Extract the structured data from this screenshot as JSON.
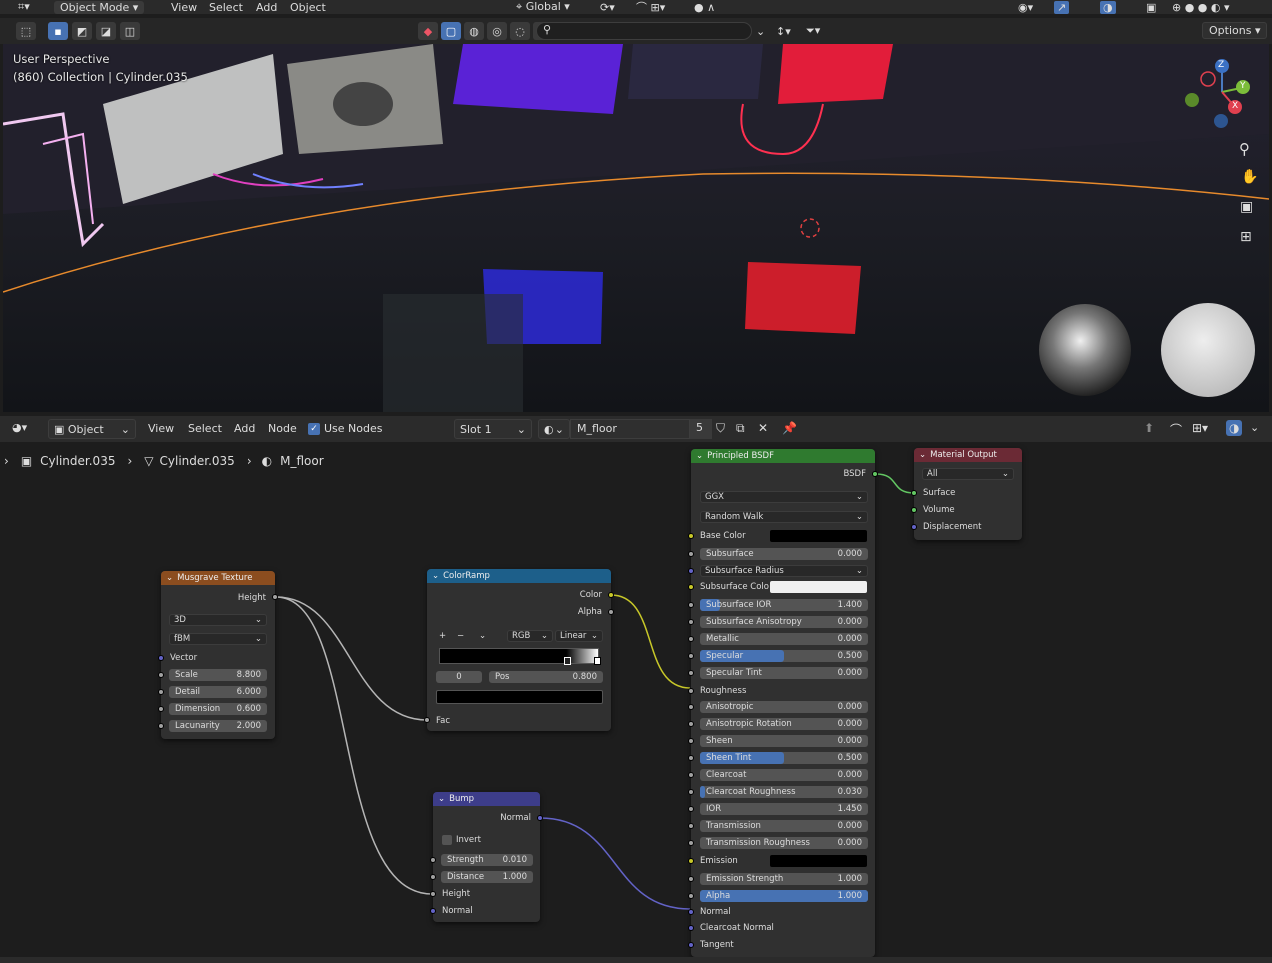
{
  "topbar": {
    "mode": "Object Mode",
    "menus": [
      "View",
      "Select",
      "Add",
      "Object"
    ],
    "orientation": "Global"
  },
  "viewport": {
    "options_label": "Options",
    "perspective": "User Perspective",
    "collection": "(860) Collection | Cylinder.035",
    "gizmo": {
      "z": "Z",
      "y": "Y",
      "x": "X"
    }
  },
  "node_header": {
    "editor_type": "Object",
    "menus": [
      "View",
      "Select",
      "Add",
      "Node"
    ],
    "use_nodes_label": "Use Nodes",
    "slot": "Slot 1",
    "material": "M_floor",
    "users": "5"
  },
  "breadcrumb": {
    "object": "Cylinder.035",
    "mesh": "Cylinder.035",
    "material": "M_floor"
  },
  "colors": {
    "musgrave_header": "#8b4d1f",
    "colorramp_header": "#1d5f8a",
    "bump_header": "#3d3d8a",
    "bsdf_header": "#2f7a2f",
    "output_header": "#6b2a35",
    "accent": "#4772b3"
  },
  "musgrave": {
    "title": "Musgrave Texture",
    "output": "Height",
    "dim": "3D",
    "type": "fBM",
    "vector": "Vector",
    "fields": [
      {
        "label": "Scale",
        "value": "8.800"
      },
      {
        "label": "Detail",
        "value": "6.000"
      },
      {
        "label": "Dimension",
        "value": "0.600"
      },
      {
        "label": "Lacunarity",
        "value": "2.000"
      }
    ]
  },
  "colorramp": {
    "title": "ColorRamp",
    "out_color": "Color",
    "out_alpha": "Alpha",
    "mode": "RGB",
    "interp": "Linear",
    "index": "0",
    "pos_label": "Pos",
    "pos_value": "0.800",
    "fac": "Fac",
    "plus": "+",
    "minus": "−"
  },
  "bump": {
    "title": "Bump",
    "output": "Normal",
    "invert": "Invert",
    "strength_label": "Strength",
    "strength": "0.010",
    "distance_label": "Distance",
    "distance": "1.000",
    "height": "Height",
    "normal": "Normal"
  },
  "bsdf": {
    "title": "Principled BSDF",
    "output": "BSDF",
    "distribution": "GGX",
    "sss_method": "Random Walk",
    "base_color": "Base Color",
    "subsurface": "Subsurface",
    "subsurface_value": "0.000",
    "subsurface_radius": "Subsurface Radius",
    "subsurface_color": "Subsurface Colo",
    "ior_sub": "Subsurface IOR",
    "ior_sub_value": "1.400",
    "fields": [
      {
        "label": "Subsurface Anisotropy",
        "value": "0.000",
        "fill": 0
      },
      {
        "label": "Metallic",
        "value": "0.000",
        "fill": 0
      },
      {
        "label": "Specular",
        "value": "0.500",
        "fill": 0.5
      },
      {
        "label": "Specular Tint",
        "value": "0.000",
        "fill": 0
      }
    ],
    "roughness": "Roughness",
    "fields2": [
      {
        "label": "Anisotropic",
        "value": "0.000",
        "fill": 0
      },
      {
        "label": "Anisotropic Rotation",
        "value": "0.000",
        "fill": 0
      },
      {
        "label": "Sheen",
        "value": "0.000",
        "fill": 0
      },
      {
        "label": "Sheen Tint",
        "value": "0.500",
        "fill": 0.5
      },
      {
        "label": "Clearcoat",
        "value": "0.000",
        "fill": 0
      },
      {
        "label": "Clearcoat Roughness",
        "value": "0.030",
        "fill": 0.03
      },
      {
        "label": "IOR",
        "value": "1.450",
        "fill": 0
      },
      {
        "label": "Transmission",
        "value": "0.000",
        "fill": 0
      },
      {
        "label": "Transmission Roughness",
        "value": "0.000",
        "fill": 0
      }
    ],
    "emission": "Emission",
    "emission_strength": "Emission Strength",
    "emission_strength_value": "1.000",
    "alpha": "Alpha",
    "alpha_value": "1.000",
    "normal": "Normal",
    "clearcoat_normal": "Clearcoat Normal",
    "tangent": "Tangent"
  },
  "output": {
    "title": "Material Output",
    "target": "All",
    "surface": "Surface",
    "volume": "Volume",
    "displacement": "Displacement"
  }
}
